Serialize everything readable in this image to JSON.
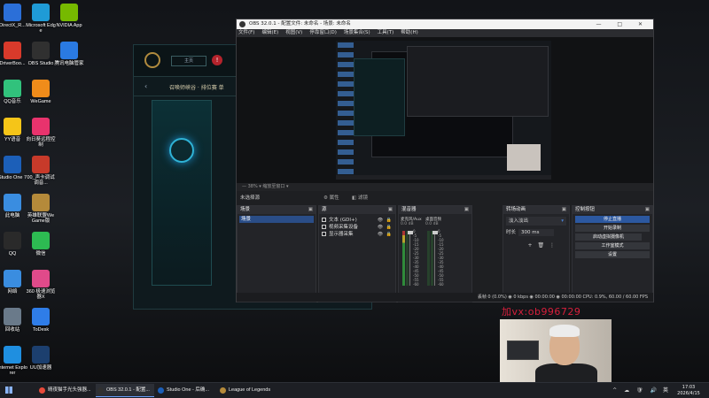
{
  "desktop": {
    "icons": [
      {
        "label": "DirectX_R...",
        "color": "#2b6fd8"
      },
      {
        "label": "Microsoft Edge",
        "color": "#1f9bd6"
      },
      {
        "label": "NVIDIA App",
        "color": "#76b900"
      },
      {
        "label": "DriverBoo...",
        "color": "#d93a2b"
      },
      {
        "label": "OBS Studio",
        "color": "#303030"
      },
      {
        "label": "腾讯电脑管家",
        "color": "#2a7ae2"
      },
      {
        "label": "QQ音乐",
        "color": "#31c27c"
      },
      {
        "label": "WeGame",
        "color": "#f08c1a"
      },
      {
        "label": "YY语音",
        "color": "#f5c518"
      },
      {
        "label": "向日葵远程控制",
        "color": "#e8336d"
      },
      {
        "label": "Studio One 7",
        "color": "#1c5fb8"
      },
      {
        "label": "00_声卡调试调音...",
        "color": "#c73a2a"
      },
      {
        "label": "此电脑",
        "color": "#3a8de0"
      },
      {
        "label": "英雄联盟WeGame版",
        "color": "#b58a3a"
      },
      {
        "label": "QQ",
        "color": "#2a2a2a"
      },
      {
        "label": "微信",
        "color": "#2dbb52"
      },
      {
        "label": "网络",
        "color": "#3a8de0"
      },
      {
        "label": "360 极速浏览器X",
        "color": "#e04a8a"
      },
      {
        "label": "回收站",
        "color": "#6a7a8a"
      },
      {
        "label": "ToDesk",
        "color": "#2f7de8"
      },
      {
        "label": "Internet Explorer",
        "color": "#1f8fe0"
      },
      {
        "label": "UU加速器",
        "color": "#1c3f6e"
      }
    ]
  },
  "lol_client": {
    "pill_label": "主页",
    "alert": "!",
    "back": "‹",
    "mode_title": "召唤师峡谷 · 排位赛 单"
  },
  "obs": {
    "title": "OBS 32.0.1 - 配置文件: 未命名 - 场景: 未命名",
    "window_buttons": "—  □  ✕",
    "menu": [
      "文件(F)",
      "编辑(E)",
      "视图(V)",
      "停靠窗口(D)",
      "场景集合(S)",
      "工具(T)",
      "帮助(H)"
    ],
    "preview_tabs": "—  38%  ▾   缩放至窗口 ▾",
    "no_source": "未选择源",
    "properties_btn": "⚙ 属性",
    "filters_btn": "◧ 滤镜",
    "docks": {
      "scenes": {
        "title": "场景",
        "items": [
          "场景"
        ],
        "footer": "+ 🗑 ⧉ ∧ ∨"
      },
      "sources": {
        "title": "源",
        "items": [
          {
            "icon": "text",
            "label": "文本 (GDI+)"
          },
          {
            "icon": "camera",
            "label": "视频采集设备"
          },
          {
            "icon": "monitor",
            "label": "显示器采集"
          }
        ],
        "footer": "+ 🗑 ⚙ ∧ ∨"
      },
      "mixer": {
        "title": "混音器",
        "channels": [
          {
            "name": "麦克风/Aux",
            "db": "0.0 dB"
          },
          {
            "name": "桌面音频",
            "db": "0.0 dB"
          }
        ],
        "scale": [
          "0",
          "-5",
          "-10",
          "-15",
          "-20",
          "-25",
          "-30",
          "-35",
          "-40",
          "-45",
          "-50",
          "-55",
          "-60"
        ],
        "footer": "⚙ ⋮"
      },
      "transitions": {
        "title": "转场动画",
        "selected": "淡入淡出",
        "duration_label": "时长",
        "duration_value": "300 ms",
        "footer": "+ 🗑 ⋮"
      },
      "controls": {
        "title": "控制按钮",
        "buttons": [
          "停止直播",
          "开始录制",
          "启动虚拟摄像机",
          "工作室模式",
          "设置"
        ]
      }
    },
    "status": "丢帧 0 (0.0%)    ◉ 0 kbps    ◉ 00:00:00    ◉ 00:00:00    CPU: 0.9%, 60.00 / 60.00 FPS"
  },
  "watermark": "加vx:ob996729",
  "taskbar": {
    "apps": [
      {
        "label": "晴夜猫手光头强器...",
        "color": "#e84a3a"
      },
      {
        "label": "OBS 32.0.1 - 配置...",
        "color": "#303030"
      },
      {
        "label": "Studio One - 后确...",
        "color": "#1c5fb8"
      },
      {
        "label": "League of Legends",
        "color": "#b58a3a"
      }
    ],
    "ime": "英",
    "clock_time": "17:03",
    "clock_date": "2026/4/15"
  }
}
